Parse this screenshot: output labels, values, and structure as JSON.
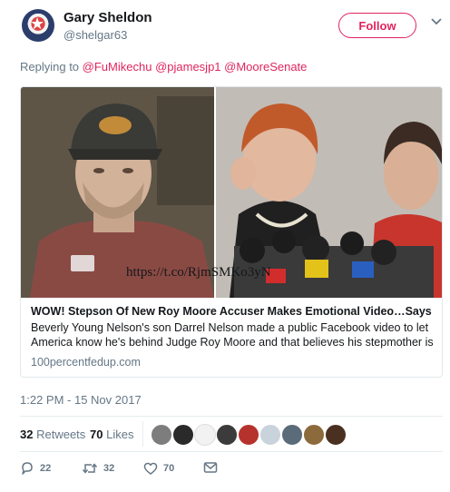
{
  "user": {
    "display_name": "Gary Sheldon",
    "handle": "@shelgar63"
  },
  "follow_button": "Follow",
  "reply_context": {
    "prefix": "Replying to",
    "mentions": [
      "@FuMikechu",
      "@pjamesjp1",
      "@MooreSenate"
    ]
  },
  "card": {
    "title": "WOW! Stepson Of New Roy Moore Accuser Makes Emotional Video…Says …",
    "description": "Beverly Young Nelson's son Darrel Nelson made a public Facebook video to let America know he's behind Judge Roy Moore and that believes his stepmother is",
    "domain": "100percentfedup.com"
  },
  "tco_link": "https://t.co/RjmSMKo3yN",
  "timestamp": "1:22 PM - 15 Nov 2017",
  "stats": {
    "retweets": {
      "count": "32",
      "label": "Retweets"
    },
    "likes": {
      "count": "70",
      "label": "Likes"
    }
  },
  "actions": {
    "reply_count": "22",
    "retweet_count": "32",
    "like_count": "70"
  },
  "colors": {
    "accent": "#e0245e",
    "muted": "#657786",
    "text": "#14171a",
    "border": "#e1e8ed"
  }
}
